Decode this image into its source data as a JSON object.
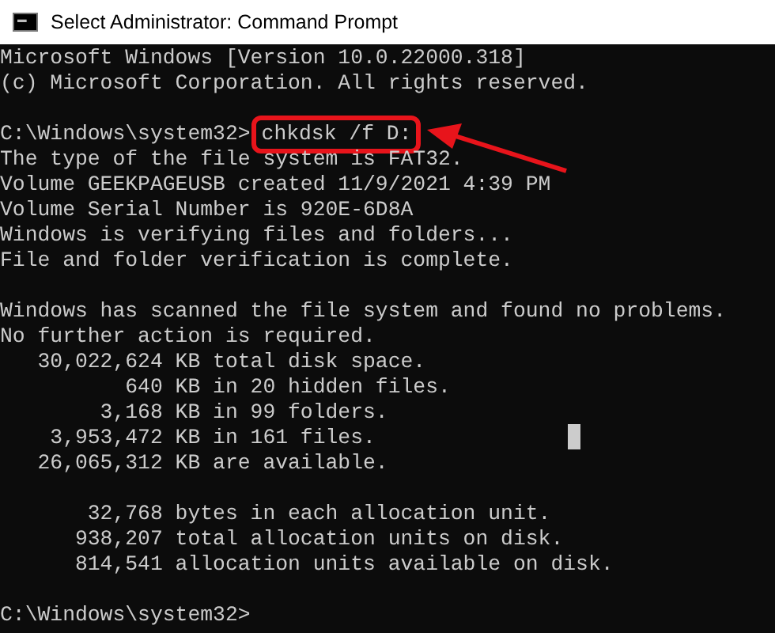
{
  "window": {
    "title": "Select Administrator: Command Prompt"
  },
  "console": {
    "blocks": [
      {
        "lines": [
          {
            "kind": "output",
            "text": "Microsoft Windows [Version 10.0.22000.318]"
          },
          {
            "kind": "output",
            "text": "(c) Microsoft Corporation. All rights reserved."
          }
        ]
      },
      {
        "lines": [
          {
            "kind": "command",
            "prompt": "C:\\Windows\\system32>",
            "text": "chkdsk /f D:",
            "highlighted": true
          },
          {
            "kind": "output",
            "text": "The type of the file system is FAT32."
          },
          {
            "kind": "output",
            "text": "Volume GEEKPAGEUSB created 11/9/2021 4:39 PM"
          },
          {
            "kind": "output",
            "text": "Volume Serial Number is 920E-6D8A"
          },
          {
            "kind": "output",
            "text": "Windows is verifying files and folders..."
          },
          {
            "kind": "output",
            "text": "File and folder verification is complete."
          }
        ]
      },
      {
        "lines": [
          {
            "kind": "output",
            "text": "Windows has scanned the file system and found no problems."
          },
          {
            "kind": "output",
            "text": "No further action is required."
          },
          {
            "kind": "output",
            "text": "   30,022,624 KB total disk space."
          },
          {
            "kind": "output",
            "text": "          640 KB in 20 hidden files."
          },
          {
            "kind": "output",
            "text": "        3,168 KB in 99 folders."
          },
          {
            "kind": "output",
            "text": "    3,953,472 KB in 161 files."
          },
          {
            "kind": "output",
            "text": "   26,065,312 KB are available."
          }
        ]
      },
      {
        "lines": [
          {
            "kind": "output",
            "text": "       32,768 bytes in each allocation unit."
          },
          {
            "kind": "output",
            "text": "      938,207 total allocation units on disk."
          },
          {
            "kind": "output",
            "text": "      814,541 allocation units available on disk."
          }
        ]
      },
      {
        "lines": [
          {
            "kind": "prompt",
            "prompt": "C:\\Windows\\system32>"
          }
        ]
      }
    ]
  }
}
